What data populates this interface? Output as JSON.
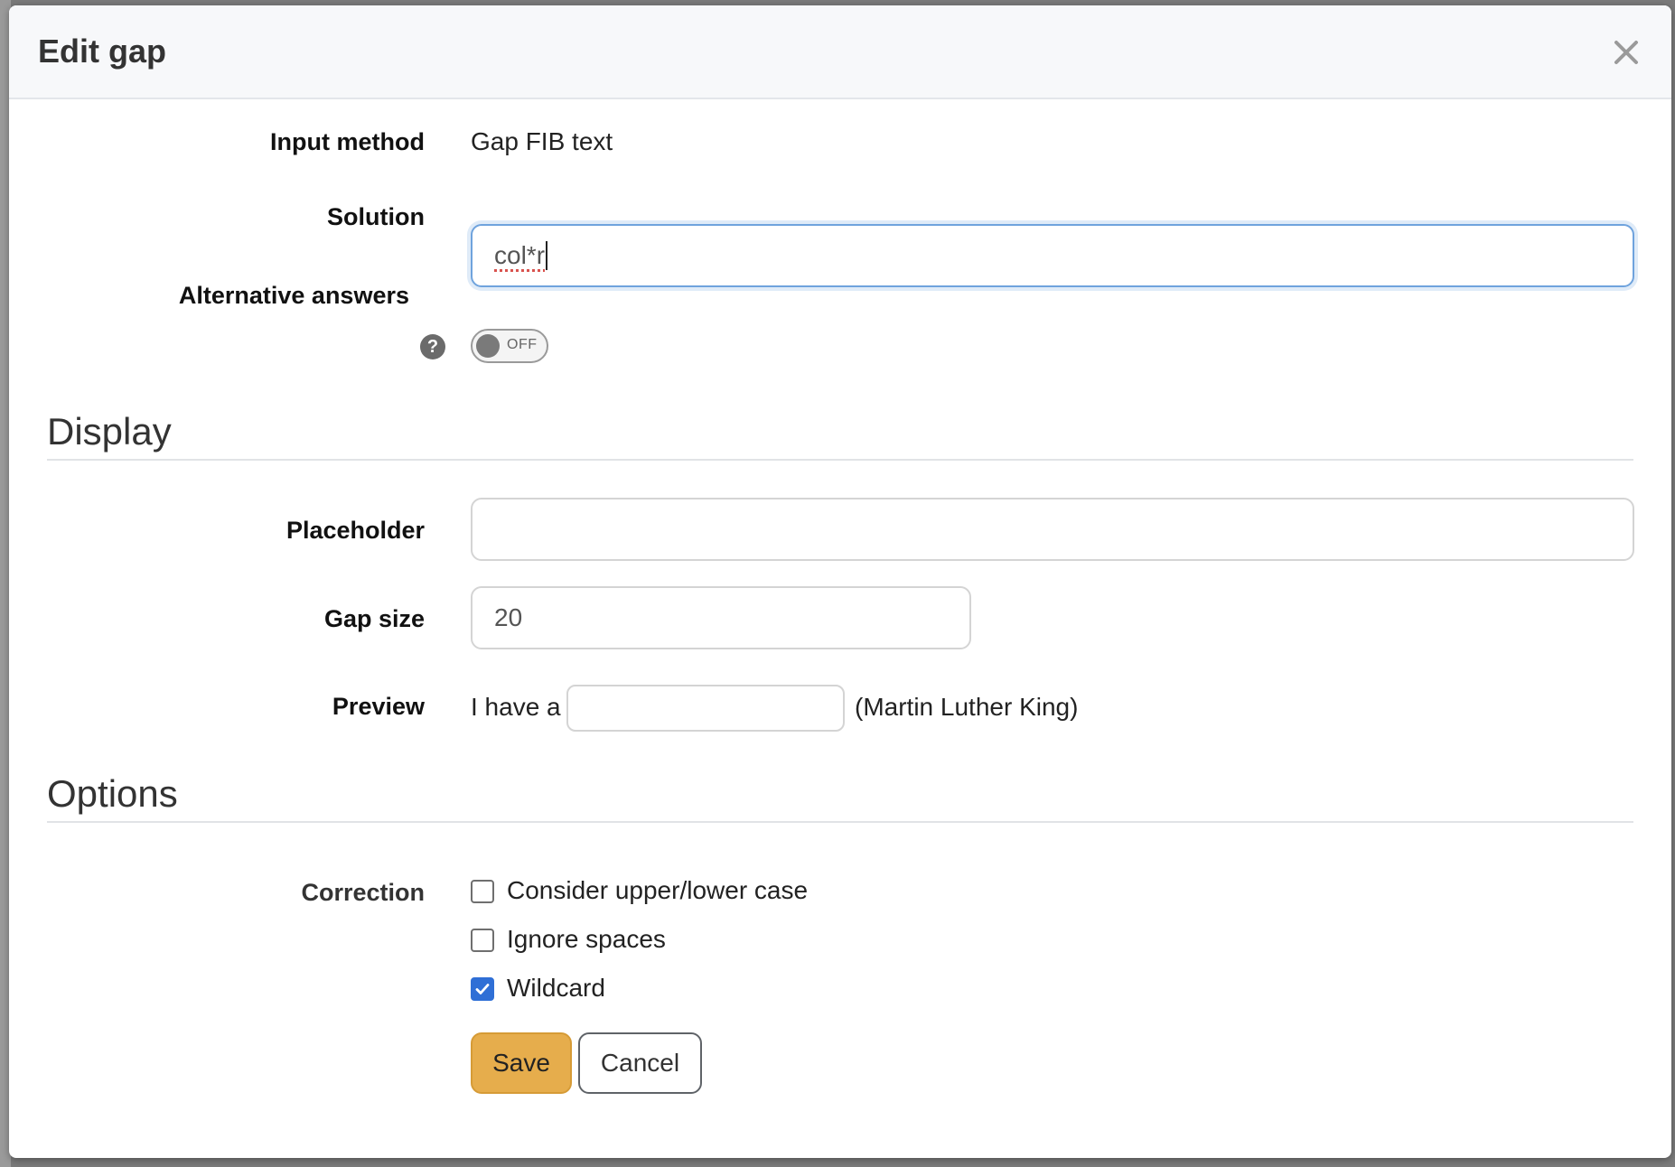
{
  "modal": {
    "title": "Edit gap",
    "close_icon": "close-icon"
  },
  "fields": {
    "input_method": {
      "label": "Input method",
      "value": "Gap FIB text"
    },
    "solution": {
      "label": "Solution",
      "value": "col*r"
    },
    "alternative_answers": {
      "label": "Alternative answers",
      "help_icon": "question-mark-icon",
      "help_glyph": "?",
      "toggle_state": "OFF"
    }
  },
  "display": {
    "section_title": "Display",
    "placeholder": {
      "label": "Placeholder",
      "value": ""
    },
    "gap_size": {
      "label": "Gap size",
      "value": "20"
    },
    "preview": {
      "label": "Preview",
      "text_before": "I have a",
      "text_after": "(Martin Luther King)"
    }
  },
  "options": {
    "section_title": "Options",
    "correction": {
      "label": "Correction",
      "choices": [
        {
          "label": "Consider upper/lower case",
          "checked": false
        },
        {
          "label": "Ignore spaces",
          "checked": false
        },
        {
          "label": "Wildcard",
          "checked": true
        }
      ]
    }
  },
  "buttons": {
    "save": "Save",
    "cancel": "Cancel"
  },
  "colors": {
    "save_button": "#e6ad4c",
    "focus_border": "#6fa3dd",
    "checkbox_checked": "#2f6fd6"
  }
}
